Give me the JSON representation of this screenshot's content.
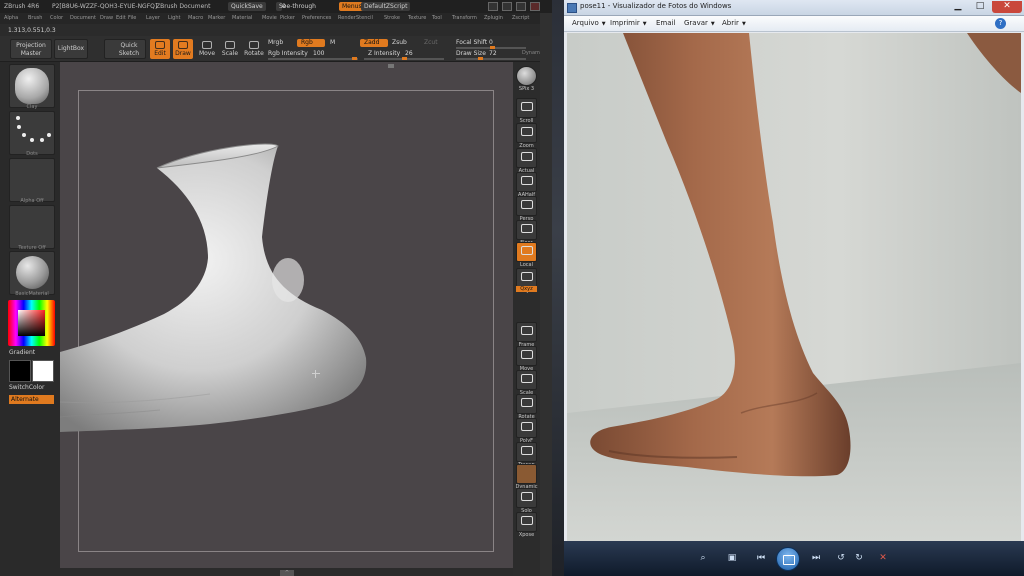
{
  "zbrush": {
    "title_bar": {
      "app": "ZBrush 4R6",
      "serial": "P2[B8U6-WZZF-QOH3-EYUE-NGFQ]",
      "doc": "ZBrush Document",
      "quicksave": "QuickSave",
      "see_through": "See-through",
      "see_through_value": "0",
      "menus_btn": "Menus",
      "script": "DefaultZScript"
    },
    "menu_items": [
      "Alpha",
      "Brush",
      "Color",
      "Document",
      "Draw",
      "Edit",
      "File",
      "Layer",
      "Light",
      "Macro",
      "Marker",
      "Material",
      "Movie",
      "Picker",
      "Preferences",
      "Render",
      "Stencil",
      "Stroke",
      "Texture",
      "Tool",
      "Transform",
      "Zplugin",
      "Zscript"
    ],
    "coords": "1.313,0.551,0.3",
    "toolbar": {
      "projection_master": "Projection Master",
      "lightbox": "LightBox",
      "quick_sketch": "Quick Sketch",
      "edit": "Edit",
      "draw": "Draw",
      "move": "Move",
      "scale": "Scale",
      "rotate": "Rotate",
      "mrgb": "Mrgb",
      "rgb": "Rgb",
      "m": "M",
      "rgb_intensity_label": "Rgb Intensity",
      "rgb_intensity": "100",
      "zadd": "Zadd",
      "zsub": "Zsub",
      "zcut": "Zcut",
      "z_intensity_label": "Z Intensity",
      "z_intensity": "26",
      "focal_shift_label": "Focal Shift",
      "focal_shift": "0",
      "draw_size_label": "Draw Size",
      "draw_size": "72",
      "dynamic": "Dynamic"
    },
    "left_shelf": {
      "brush_label": "Clay",
      "stroke_label": "Dots",
      "alpha_label": "Alpha Off",
      "texture_label": "Texture Off",
      "material_label": "BasicMaterial",
      "gradient": "Gradient",
      "switch_color": "SwitchColor",
      "alternate": "Alternate"
    },
    "right_shelf": {
      "spix_label": "SPix",
      "spix_value": "3",
      "scroll": "Scroll",
      "zoom": "Zoom",
      "actual": "Actual",
      "aahalf": "AAHalf",
      "persp": "Persp",
      "floor": "Floor",
      "local": "Local",
      "lsym": "L.Sym",
      "qxyz": "Qxyz",
      "frame": "Frame",
      "move": "Move",
      "scale": "Scale",
      "rotate": "Rotate",
      "polyf": "PolyF",
      "transp": "Transp",
      "dynamic": "Dynamic",
      "solo": "Solo",
      "xpose": "Xpose"
    }
  },
  "photo_viewer": {
    "title": "pose11 - Visualizador de Fotos do Windows",
    "menu": [
      "Arquivo",
      "Imprimir",
      "Email",
      "Gravar",
      "Abrir"
    ],
    "menu_has_caret": [
      true,
      true,
      false,
      true,
      true
    ],
    "help_label": "?",
    "controls": {
      "minimize": "▁",
      "maximize": "□",
      "close": "✕"
    }
  },
  "colors": {
    "zbrush_accent": "#e07a1f",
    "viewport_bg": "#4a4548",
    "photo_viewer_chrome": "#dfe7f2",
    "photo_viewer_bottom": "#1b2a40"
  },
  "icons": {
    "zoom": "magnifier-icon",
    "actual_size": "actual-size-icon",
    "previous": "previous-icon",
    "slideshow": "slideshow-icon",
    "next": "next-icon",
    "rotate_ccw": "rotate-ccw-icon",
    "rotate_cw": "rotate-cw-icon",
    "delete": "delete-icon"
  }
}
